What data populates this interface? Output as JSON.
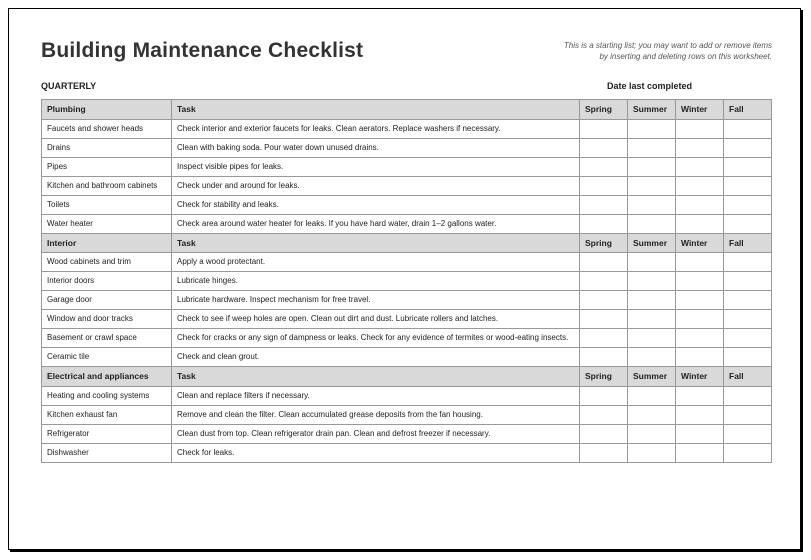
{
  "title": "Building Maintenance Checklist",
  "note_line1": "This is a starting list; you may want to add or remove items",
  "note_line2": "by inserting and deleting rows on this worksheet.",
  "subhead": "QUARTERLY",
  "date_label": "Date last completed",
  "columns": {
    "task": "Task",
    "spring": "Spring",
    "summer": "Summer",
    "winter": "Winter",
    "fall": "Fall"
  },
  "sections": [
    {
      "name": "Plumbing",
      "rows": [
        {
          "item": "Faucets and shower heads",
          "task": "Check interior and exterior faucets for leaks. Clean aerators. Replace washers if necessary."
        },
        {
          "item": "Drains",
          "task": "Clean with baking soda. Pour water down unused drains."
        },
        {
          "item": "Pipes",
          "task": "Inspect visible pipes for leaks."
        },
        {
          "item": "Kitchen and bathroom cabinets",
          "task": "Check under and around for leaks."
        },
        {
          "item": "Toilets",
          "task": "Check for stability and leaks."
        },
        {
          "item": "Water heater",
          "task": "Check area around water heater for leaks. If you have hard water, drain 1–2 gallons water."
        }
      ]
    },
    {
      "name": "Interior",
      "rows": [
        {
          "item": "Wood cabinets and trim",
          "task": "Apply a wood protectant."
        },
        {
          "item": "Interior doors",
          "task": "Lubricate hinges."
        },
        {
          "item": "Garage door",
          "task": "Lubricate hardware. Inspect mechanism for free travel."
        },
        {
          "item": "Window and door tracks",
          "task": "Check to see if weep holes are open. Clean out dirt and dust. Lubricate rollers and latches."
        },
        {
          "item": "Basement or crawl space",
          "task": "Check for cracks or any sign of dampness or leaks. Check for any evidence of termites or wood-eating insects."
        },
        {
          "item": "Ceramic tile",
          "task": "Check and clean grout."
        }
      ]
    },
    {
      "name": "Electrical and appliances",
      "rows": [
        {
          "item": "Heating and cooling systems",
          "task": "Clean and replace filters if necessary."
        },
        {
          "item": "Kitchen exhaust fan",
          "task": "Remove and clean the filter. Clean accumulated grease deposits from the fan housing."
        },
        {
          "item": "Refrigerator",
          "task": "Clean dust from top. Clean refrigerator drain pan. Clean and defrost freezer if necessary."
        },
        {
          "item": "Dishwasher",
          "task": "Check for leaks."
        }
      ]
    }
  ]
}
